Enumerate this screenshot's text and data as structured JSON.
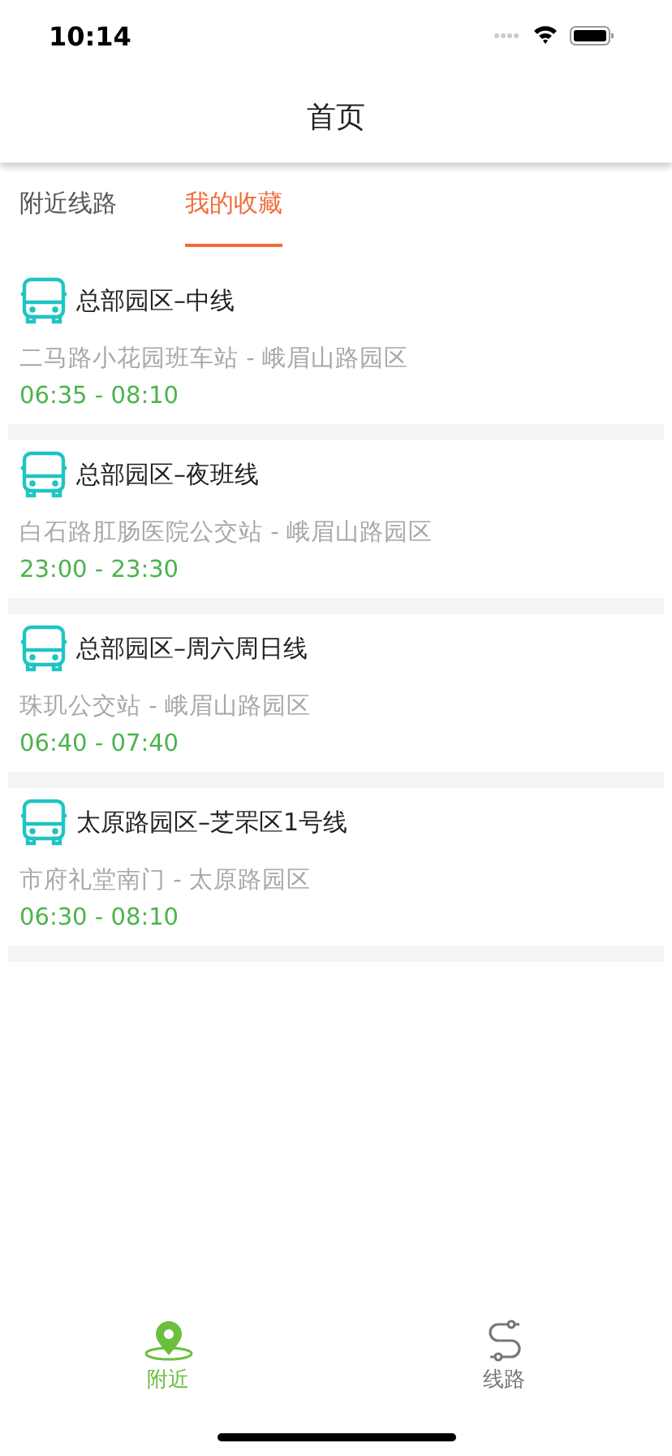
{
  "status_bar": {
    "time": "10:14"
  },
  "nav": {
    "title": "首页"
  },
  "tabs": [
    {
      "label": "附近线路",
      "selected": false
    },
    {
      "label": "我的收藏",
      "selected": true
    }
  ],
  "routes": [
    {
      "name": "总部园区–中线",
      "stops": "二马路小花园班车站 - 峨眉山路园区",
      "hours": "06:35 - 08:10"
    },
    {
      "name": "总部园区–夜班线",
      "stops": "白石路肛肠医院公交站 - 峨眉山路园区",
      "hours": "23:00 - 23:30"
    },
    {
      "name": "总部园区–周六周日线",
      "stops": "珠玑公交站 - 峨眉山路园区",
      "hours": "06:40 - 07:40"
    },
    {
      "name": "太原路园区–芝罘区1号线",
      "stops": "市府礼堂南门 - 太原路园区",
      "hours": "06:30 - 08:10"
    }
  ],
  "bottom_tabs": [
    {
      "label": "附近",
      "kind": "pin",
      "selected": true
    },
    {
      "label": "线路",
      "kind": "route",
      "selected": false
    }
  ]
}
